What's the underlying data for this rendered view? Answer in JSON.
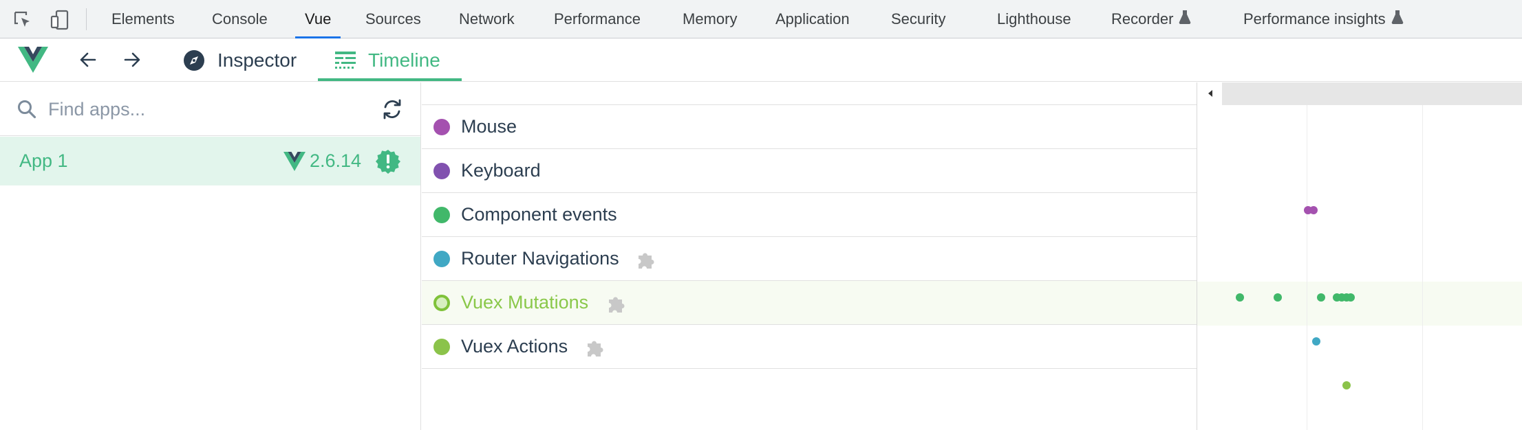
{
  "devtools": {
    "tabs": [
      {
        "label": "Elements"
      },
      {
        "label": "Console"
      },
      {
        "label": "Vue",
        "active": true
      },
      {
        "label": "Sources"
      },
      {
        "label": "Network"
      },
      {
        "label": "Performance"
      },
      {
        "label": "Memory"
      },
      {
        "label": "Application"
      },
      {
        "label": "Security"
      },
      {
        "label": "Lighthouse"
      },
      {
        "label": "Recorder",
        "experimental": true
      },
      {
        "label": "Performance insights",
        "experimental": true
      }
    ],
    "icons": [
      "inspect-element-icon",
      "device-toolbar-icon",
      "flask-icon"
    ]
  },
  "vue_nav": {
    "tabs": [
      {
        "label": "Inspector",
        "icon": "compass-icon"
      },
      {
        "label": "Timeline",
        "icon": "timeline-icon",
        "active": true
      }
    ],
    "icons": [
      "vue-logo",
      "back-arrow-icon",
      "forward-arrow-icon"
    ]
  },
  "apps": {
    "search_placeholder": "Find apps...",
    "search_value": "",
    "items": [
      {
        "name": "App 1",
        "version": "2.6.14",
        "selected": true,
        "warning": true
      }
    ]
  },
  "timeline": {
    "layers": [
      {
        "label": "Mouse",
        "color": "#a451af",
        "plugin": false
      },
      {
        "label": "Keyboard",
        "color": "#8151af",
        "plugin": false
      },
      {
        "label": "Component events",
        "color": "#41b86a",
        "plugin": false
      },
      {
        "label": "Router Navigations",
        "color": "#40a8c4",
        "plugin": true
      },
      {
        "label": "Vuex Mutations",
        "color": "#8bc34a",
        "plugin": true,
        "selected": true
      },
      {
        "label": "Vuex Actions",
        "color": "#8bc34a",
        "plugin": true
      }
    ],
    "colors": {
      "accent": "#42b883",
      "selected_row": "#f7fbf2",
      "plugin_icon": "#c8c8c8"
    }
  }
}
